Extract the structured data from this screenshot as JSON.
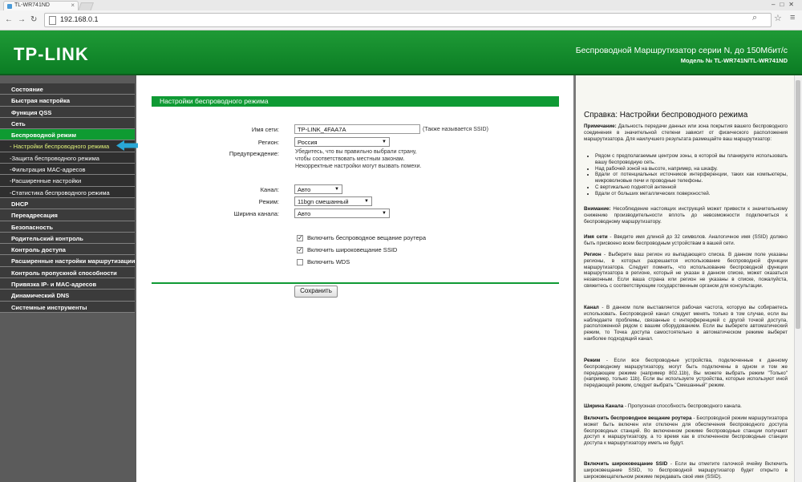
{
  "browser": {
    "tab_title": "TL-WR741ND",
    "url": "192.168.0.1",
    "icons": [
      "back-icon",
      "forward-icon",
      "reload-icon",
      "page-icon",
      "search-icon",
      "star-icon",
      "menu-icon"
    ]
  },
  "header": {
    "logo": "TP-LINK",
    "title": "Беспроводной Маршрутизатор серии N, до 150Мбит/с",
    "model": "Модель № TL-WR741N/TL-WR741ND"
  },
  "sidebar": {
    "items": [
      {
        "label": "Состояние"
      },
      {
        "label": "Быстрая настройка"
      },
      {
        "label": "Функция QSS"
      },
      {
        "label": "Сеть"
      },
      {
        "label": "Беспроводной режим"
      },
      {
        "label": "- Настройки беспроводного режима"
      },
      {
        "label": "-Защита беспроводного режима"
      },
      {
        "label": "-Фильтрация MAC-адресов"
      },
      {
        "label": "-Расширенные настройки"
      },
      {
        "label": "-Статистика беспроводного режима"
      },
      {
        "label": "DHCP"
      },
      {
        "label": "Переадресация"
      },
      {
        "label": "Безопасность"
      },
      {
        "label": "Родительский контроль"
      },
      {
        "label": "Контроль доступа"
      },
      {
        "label": "Расширенные настройки маршрутизации"
      },
      {
        "label": "Контроль пропускной способности"
      },
      {
        "label": "Привязка IP- и MAC-адресов"
      },
      {
        "label": "Динамический DNS"
      },
      {
        "label": "Системные инструменты"
      }
    ]
  },
  "form": {
    "section_title": "Настройки беспроводного режима",
    "ssid_label": "Имя сети:",
    "ssid_value": "TP-LINK_4FAA7A",
    "ssid_hint": "(Также называется SSID)",
    "region_label": "Регион:",
    "region_value": "Россия",
    "warning_label": "Предупреждение:",
    "warning_lines": [
      "Убедитесь, что вы правильно выбрали страну,",
      "чтобы соответствовать местным законам.",
      "Некорректные настройки могут вызвать помехи."
    ],
    "channel_label": "Канал:",
    "channel_value": "Авто",
    "mode_label": "Режим:",
    "mode_value": "11bgn смешанный",
    "width_label": "Ширина канала:",
    "width_value": "Авто",
    "checkboxes": [
      {
        "label": "Включить беспроводное вещание роутера",
        "checked": "true"
      },
      {
        "label": "Включить широковещание SSID",
        "checked": "true"
      },
      {
        "label": "Включить WDS",
        "checked": "false"
      }
    ],
    "save_label": "Сохранить"
  },
  "help": {
    "title": "Справка: Настройки беспроводного режима",
    "note_head": "Примечание:",
    "note": "Дальность передачи данных или зона покрытия вашего беспроводного соединения в значительной степени зависит от физического расположения маршрутизатора. Для наилучшего результата размещайте ваш маршрутизатор:",
    "bullets": [
      "Рядом с предполагаемым центром зоны, в которой вы планируете использовать вашу беспроводную сеть.",
      "Над рабочей зоной на высоте, например, на шкафу.",
      "Вдали от потенциальных источников интерференции, таких как компьютеры, микроволновые печи и проводные телефоны.",
      "С вертикально поднятой антенной",
      "Вдали от больших металлических поверхностей."
    ],
    "attention_head": "Внимание:",
    "attention": "Несоблюдение настоящих инструкций может привести к значительному снижению производительности вплоть до невозможности подключиться к беспроводному маршрутизатору.",
    "ssid_head": "Имя сети",
    "ssid": "- Введите имя длиной до 32 символов. Аналогичное имя (SSID) должно быть присвоено всем беспроводным устройствам в вашей сети.",
    "region_head": "Регион",
    "region": "- Выберите ваш регион из выпадающего списка. В данном поле указаны регионы, в которых разрешается использование беспроводной функции маршрутизатора. Следует помнить, что использование беспроводной функции маршрутизатора в регионе, который не указан в данном списке, может оказаться незаконным. Если ваша страна или регион не указаны в списке, пожалуйста, свяжитесь с соответствующим государственным органом для консультации.",
    "channel_head": "Канал",
    "channel": "- В данном поле выставляется рабочая частота, которую вы собираетесь использовать. Беспроводной канал следует менять только в том случае, если вы наблюдаете проблемы, связанные с интерференцией с другой точкой доступа, расположенной рядом с вашим оборудованием. Если вы выберете автоматический режим, то Точка доступа самостоятельно в автоматическом режиме выберет наиболее подходящий канал.",
    "mode_head": "Режим",
    "mode": "- Если все беспроводные устройства, подключенные к данному беспроводному маршрутизатору, могут быть подключены в одном и том же передающем режиме (например 802.11b), Вы можете выбрать режим \"Только\" (например, только 11b). Если вы используете устройства, которые используют иной передающий режим, следует выбрать \"Смешанный\" режим.",
    "width_head": "Ширина Канала",
    "width": "- Пропускная способность беспроводного канала.",
    "bcast_head": "Включить беспроводное вещание роутера",
    "bcast": "- Беспроводной режим маршрутизатора может быть включен или отключен для обеспечения беспроводного доступа беспроводных станций. Во включенном режиме беспроводные станции получают доступ к маршрутизатору, а то время как в отключенном беспроводные станции доступа к маршрутизатору иметь не будут.",
    "ssidb_head": "Включить широковещание SSID",
    "ssidb": "- Если вы отметите галочкой ячейку Включить широковещание SSID, то беспроводной маршрутизатор будет открыто в широковещательном режиме передавать своё имя (SSID)."
  }
}
